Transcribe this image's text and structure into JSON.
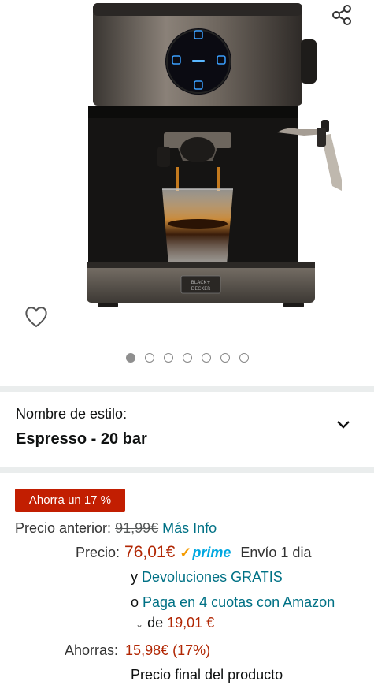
{
  "gallery": {
    "dots_count": 7,
    "active_dot": 0,
    "image_brand_text": "BLACK+DECKER"
  },
  "style": {
    "label": "Nombre de estilo:",
    "value": "Espresso - 20 bar"
  },
  "pricing": {
    "badge": "Ahorra un 17 %",
    "previous_label": "Precio anterior:",
    "previous_value": "91,99€",
    "more_info": "Más Info",
    "price_label": "Precio:",
    "price_value": "76,01€",
    "prime_text": "prime",
    "shipping": "Envío 1 dia",
    "returns_prefix": "y",
    "returns_link": "Devoluciones GRATIS",
    "installments_prefix": "o",
    "installments_link": "Paga en 4 cuotas con Amazon",
    "installments_de": "de",
    "installments_value": "19,01 €",
    "savings_label": "Ahorras:",
    "savings_value": "15,98€ (17%)",
    "final_note": "Precio final del producto"
  },
  "colors": {
    "badge_red": "#c21e01",
    "price_red": "#b12704",
    "link_teal": "#007185",
    "prime_blue": "#00a8e1",
    "prime_check": "#f49b00"
  },
  "icons": [
    "share-icon",
    "heart-icon",
    "chevron-down-icon",
    "prime-check-icon",
    "small-chevron-down-icon"
  ]
}
